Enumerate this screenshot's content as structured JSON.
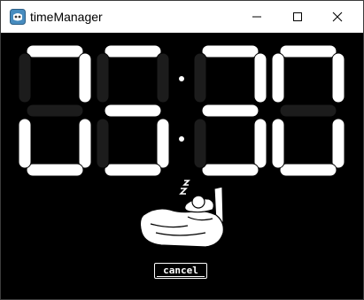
{
  "window": {
    "title": "timeManager",
    "icons": {
      "app": "godot-app-icon",
      "minimize": "minimize-icon",
      "maximize": "maximize-icon",
      "close": "close-icon"
    }
  },
  "clock": {
    "display": "88:88",
    "digits": [
      "8",
      "8",
      "8",
      "8"
    ],
    "inactive_segments": [
      [
        "f",
        "g"
      ],
      [
        "f",
        "b",
        "e"
      ],
      [
        "e",
        "f"
      ],
      [
        "g"
      ]
    ],
    "colors": {
      "on": "#ffffff",
      "off": "#1c1c1c",
      "background": "#000000"
    }
  },
  "illustration": {
    "icon": "sleeping-person-in-bed-icon"
  },
  "actions": {
    "cancel_label": "cancel"
  }
}
